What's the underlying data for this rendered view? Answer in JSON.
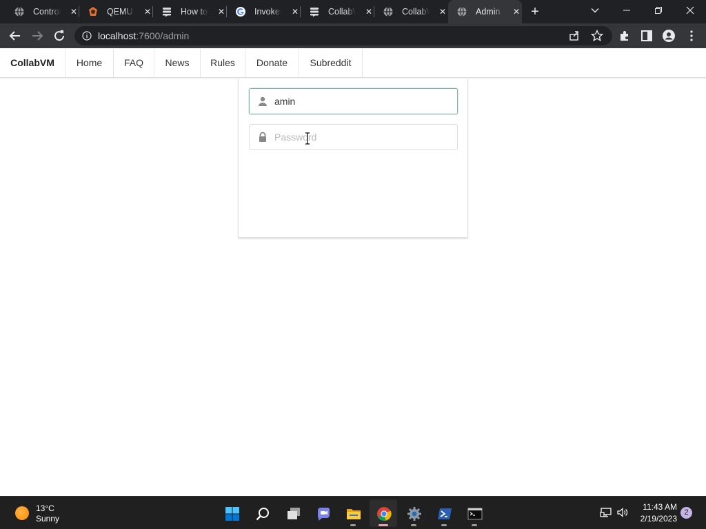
{
  "browser": {
    "tabs": [
      {
        "title": "Control",
        "icon": "globe-icon"
      },
      {
        "title": "QEMU for",
        "icon": "qemu-icon"
      },
      {
        "title": "How to",
        "icon": "stackexchange-icon"
      },
      {
        "title": "Invoke-",
        "icon": "google-icon"
      },
      {
        "title": "CollabVM",
        "icon": "stackexchange-icon"
      },
      {
        "title": "CollabVM",
        "icon": "globe-icon"
      },
      {
        "title": "Admin",
        "icon": "globe-icon",
        "active": true
      }
    ],
    "address": {
      "host": "localhost",
      "path": ":7600/admin"
    }
  },
  "navbar": {
    "brand": "CollabVM",
    "links": [
      "Home",
      "FAQ",
      "News",
      "Rules",
      "Donate",
      "Subreddit"
    ]
  },
  "login": {
    "username_value": "amin",
    "password_placeholder": "Password"
  },
  "taskbar": {
    "weather": {
      "temp": "13°C",
      "condition": "Sunny"
    },
    "clock": {
      "time": "11:43 AM",
      "date": "2/19/2023"
    },
    "notifications": "2"
  },
  "colors": {
    "focus_border": "#7fb3a8",
    "chrome_dark": "#202124",
    "chrome_toolbar": "#35363a"
  }
}
